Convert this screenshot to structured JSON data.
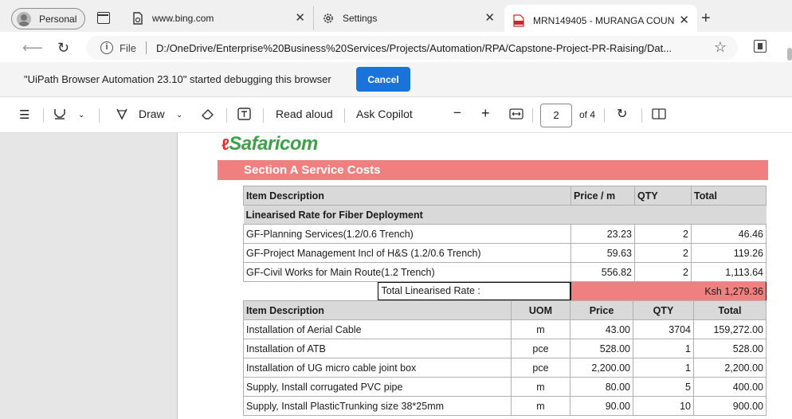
{
  "browser": {
    "profile_label": "Personal",
    "tabs": [
      {
        "title": "www.bing.com",
        "icon": "bing-page-icon"
      },
      {
        "title": "Settings",
        "icon": "gear-icon"
      },
      {
        "title": "MRN149405 - MURANGA COUN",
        "icon": "pdf-icon",
        "active": true
      }
    ],
    "address": {
      "file_label": "File",
      "url": "D:/OneDrive/Enterprise%20Business%20Services/Projects/Automation/RPA/Capstone-Project-PR-Raising/Dat..."
    }
  },
  "infobar": {
    "message": "\"UiPath Browser Automation 23.10\" started debugging this browser",
    "cancel_label": "Cancel"
  },
  "pdf_toolbar": {
    "draw_label": "Draw",
    "read_aloud_label": "Read aloud",
    "ask_copilot_label": "Ask Copilot",
    "page_current": "2",
    "page_total": "of 4"
  },
  "document": {
    "logo_text": "Safaricom",
    "section_title": "Section A Service Costs",
    "table_a": {
      "headers": [
        "Item Description",
        "Price / m",
        "QTY",
        "Total"
      ],
      "subheading": "Linearised Rate for Fiber Deployment",
      "rows": [
        [
          "GF-Planning Services(1.2/0.6 Trench)",
          "23.23",
          "2",
          "46.46"
        ],
        [
          "GF-Project Management Incl of H&S (1.2/0.6 Trench)",
          "59.63",
          "2",
          "119.26"
        ],
        [
          "GF-Civil Works for Main Route(1.2 Trench)",
          "556.82",
          "2",
          "1,113.64"
        ]
      ],
      "total_label": "Total Linearised Rate :",
      "total_value": "Ksh 1,279.36"
    },
    "table_b": {
      "headers": [
        "Item Description",
        "UOM",
        "Price",
        "QTY",
        "Total"
      ],
      "rows": [
        [
          "Installation of Aerial Cable",
          "m",
          "43.00",
          "3704",
          "159,272.00"
        ],
        [
          "Installation of ATB",
          "pce",
          "528.00",
          "1",
          "528.00"
        ],
        [
          "Installation of UG micro cable joint box",
          "pce",
          "2,200.00",
          "1",
          "2,200.00"
        ],
        [
          "Supply, Install corrugated PVC pipe",
          "m",
          "80.00",
          "5",
          "400.00"
        ],
        [
          "Supply, Install PlasticTrunking size 38*25mm",
          "m",
          "90.00",
          "10",
          "900.00"
        ]
      ]
    }
  }
}
